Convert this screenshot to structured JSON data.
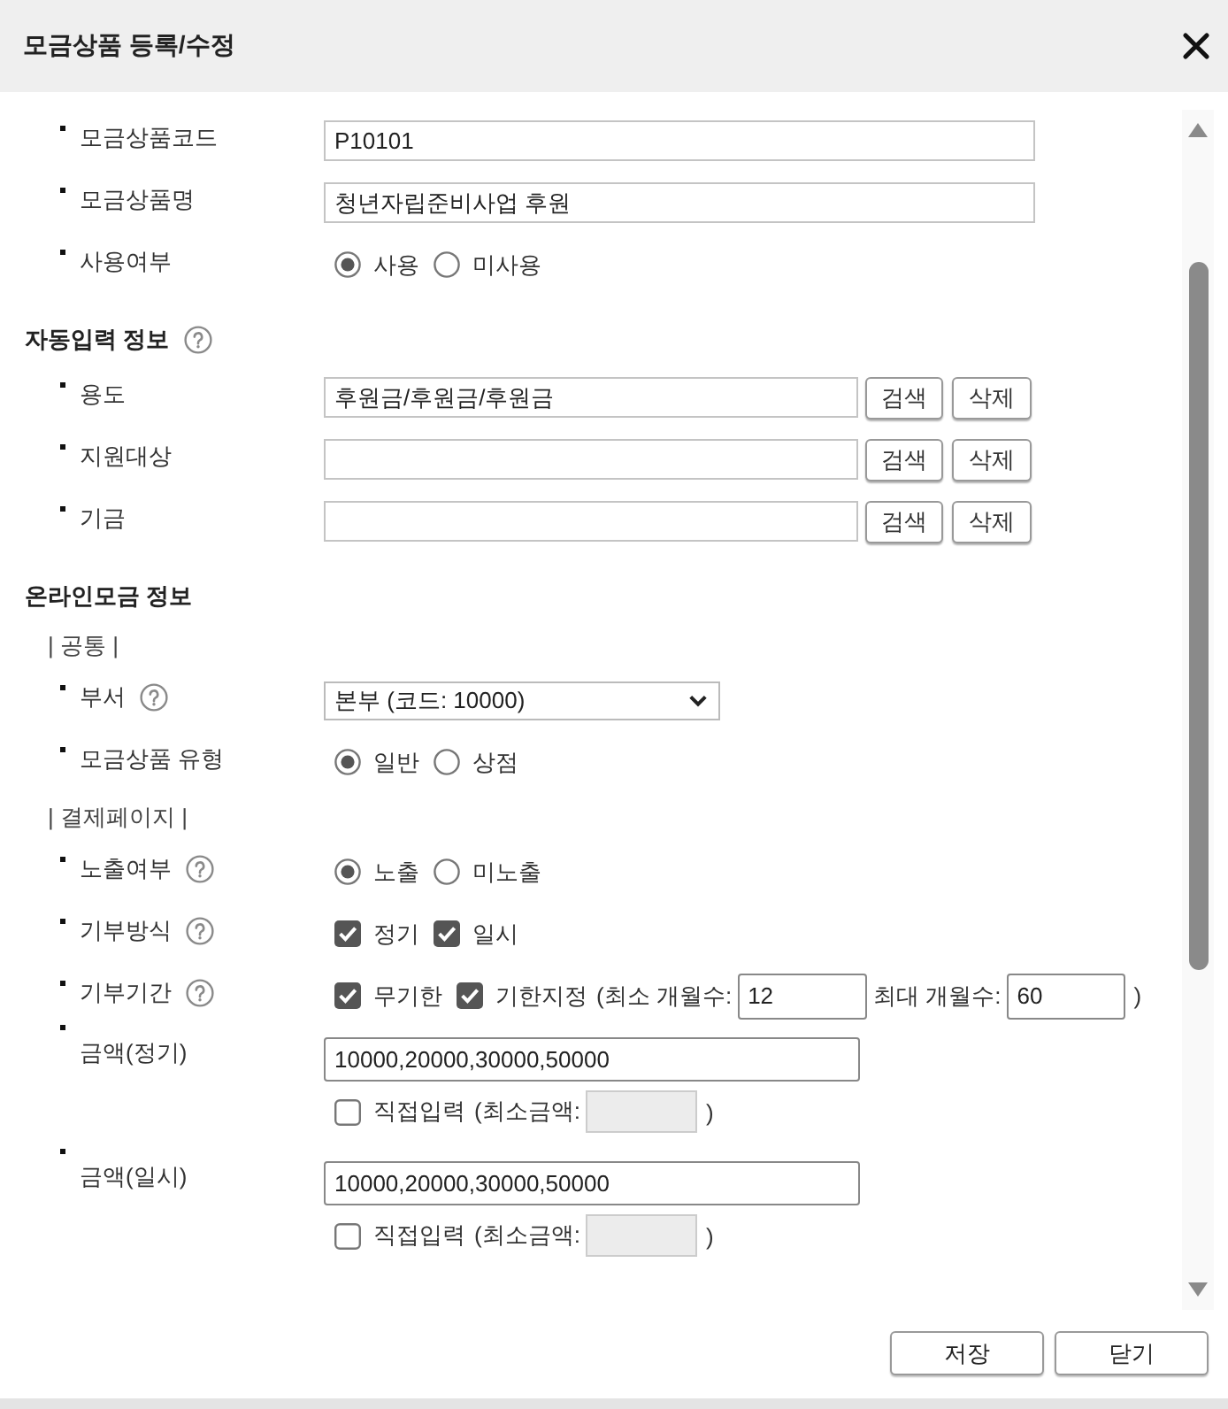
{
  "window": {
    "title": "모금상품 등록/수정"
  },
  "fields": [
    {
      "kind": "text",
      "label": "모금상품코드",
      "required": true,
      "help": false,
      "value": "P10101"
    },
    {
      "kind": "text",
      "label": "모금상품명",
      "required": true,
      "help": false,
      "value": "청년자립준비사업 후원"
    },
    {
      "kind": "radio",
      "label": "사용여부",
      "required": true,
      "help": false,
      "options": [
        {
          "label": "사용",
          "selected": true
        },
        {
          "label": "미사용",
          "selected": false
        }
      ]
    }
  ],
  "sections": [
    {
      "title": "자동입력 정보",
      "help": true,
      "fields": [
        {
          "kind": "lookup",
          "label": "용도",
          "required": true,
          "help": false,
          "value": "후원금/후원금/후원금",
          "buttons": [
            "검색",
            "삭제"
          ]
        },
        {
          "kind": "lookup",
          "label": "지원대상",
          "required": true,
          "help": false,
          "buttons": [
            "검색",
            "삭제"
          ]
        },
        {
          "kind": "lookup",
          "label": "기금",
          "required": true,
          "help": false,
          "buttons": [
            "검색",
            "삭제"
          ]
        }
      ]
    },
    {
      "title": "온라인모금 정보",
      "help": false,
      "subsections": [
        {
          "title": "| 공통 |",
          "fields": [
            {
              "kind": "select",
              "label": "부서",
              "required": true,
              "help": true,
              "value": "본부 (코드: 10000)"
            },
            {
              "kind": "radio",
              "label": "모금상품 유형",
              "required": true,
              "help": false,
              "options": [
                {
                  "label": "일반",
                  "selected": true
                },
                {
                  "label": "상점",
                  "selected": false
                }
              ]
            }
          ]
        },
        {
          "title": "| 결제페이지 |",
          "fields": [
            {
              "kind": "radio",
              "label": "노출여부",
              "required": true,
              "help": true,
              "options": [
                {
                  "label": "노출",
                  "selected": true
                },
                {
                  "label": "미노출",
                  "selected": false
                }
              ]
            },
            {
              "kind": "checks",
              "label": "기부방식",
              "required": true,
              "help": true,
              "options": [
                {
                  "label": "정기",
                  "checked": true
                },
                {
                  "label": "일시",
                  "checked": true
                }
              ]
            },
            {
              "kind": "period",
              "label": "기부기간",
              "required": true,
              "help": true,
              "options": [
                {
                  "label": "무기한",
                  "checked": true
                },
                {
                  "label": "기한지정",
                  "checked": true
                }
              ],
              "min_label": "(최소 개월수:",
              "min_value": "12",
              "max_label": "최대 개월수:",
              "max_value": "60",
              "close": ")"
            },
            {
              "kind": "amount",
              "label": "금액(정기)",
              "required": true,
              "help": false,
              "value": "10000,20000,30000,50000",
              "direct": {
                "label": "직접입력",
                "checked": false,
                "min_label": "(최소금액:",
                "min_field": {
                  "disabled": true
                },
                "close": ")"
              }
            },
            {
              "kind": "amount",
              "label": "금액(일시)",
              "required": true,
              "help": false,
              "value": "10000,20000,30000,50000",
              "direct": {
                "label": "직접입력",
                "checked": false,
                "min_label": "(최소금액:",
                "min_field": {
                  "disabled": true
                },
                "close": ")"
              }
            }
          ]
        }
      ]
    }
  ],
  "buttons": [
    "저장",
    "닫기"
  ]
}
